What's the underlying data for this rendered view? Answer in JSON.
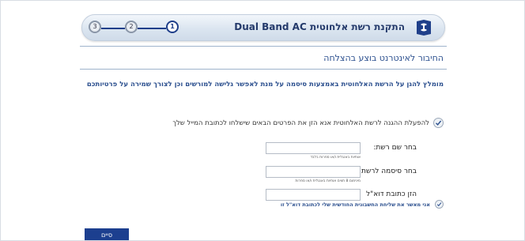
{
  "header": {
    "title": "התקנת רשת אלחוטית Dual Band AC",
    "logo_icon": "router-logo-icon",
    "steps": [
      "1",
      "2",
      "3"
    ],
    "current_step": "1"
  },
  "main": {
    "heading": "החיבור לאינטרנט בוצע בהצלחה",
    "intro": "מומלץ להגן על הרשת האלחוטית באמצעות סיסמה על מנת לאפשר גלישה למורשים וכן לצורך שמירה על פרטיותכם",
    "instruction": "להפעלת ההגנה לרשת האלחוטית אנא הזן את הפרטים הבאים שישלחו לכתובת המייל שלך"
  },
  "form": {
    "network_name_label": "בחר שם רשת:",
    "network_name_value": "",
    "network_name_hint": "אותיות באנגלית ו/או ספרות בלבד",
    "password_label": "בחר סיסמה לרשת:",
    "password_value": "",
    "password_hint": "מינימום 8 תווים אותיות באנגלית ו/או ספרות",
    "email_label": "הזן כתובת דוא\"ל",
    "email_value": ""
  },
  "agree": {
    "label": "אני מאשר את שליחת החשבונית החודשית שלי לכתובת דוא\"ל זו"
  },
  "actions": {
    "finish_label": "סיים"
  },
  "colors": {
    "accent": "#2b4f8e",
    "button": "#1c3f8f",
    "step_active": "#1f3f8a"
  }
}
